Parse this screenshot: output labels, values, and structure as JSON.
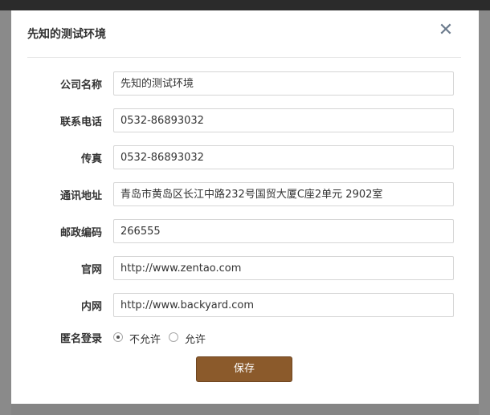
{
  "dialog": {
    "title": "先知的测试环境",
    "close_glyph": "✕"
  },
  "fields": [
    {
      "label": "公司名称",
      "value": "先知的测试环境"
    },
    {
      "label": "联系电话",
      "value": "0532-86893032"
    },
    {
      "label": "传真",
      "value": "0532-86893032"
    },
    {
      "label": "通讯地址",
      "value": "青岛市黄岛区长江中路232号国贸大厦C座2单元 2902室"
    },
    {
      "label": "邮政编码",
      "value": "266555"
    },
    {
      "label": "官网",
      "value": "http://www.zentao.com"
    },
    {
      "label": "内网",
      "value": "http://www.backyard.com"
    }
  ],
  "anonymous_login": {
    "label": "匿名登录",
    "options": [
      {
        "label": "不允许",
        "selected": true
      },
      {
        "label": "允许",
        "selected": false
      }
    ]
  },
  "save_label": "保存",
  "colors": {
    "button": "#8b5a2b",
    "overlay": "#858585",
    "icon": "#6b7a8c"
  }
}
